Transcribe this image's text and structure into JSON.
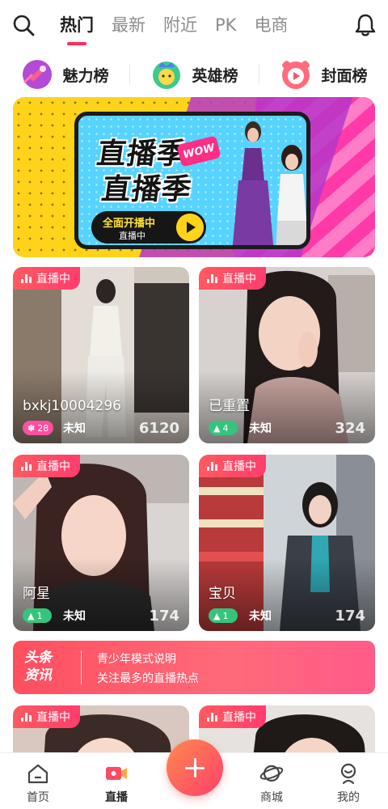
{
  "top_nav": {
    "tabs": [
      {
        "label": "热门",
        "active": true
      },
      {
        "label": "最新",
        "active": false
      },
      {
        "label": "附近",
        "active": false
      },
      {
        "label": "PK",
        "active": false
      },
      {
        "label": "电商",
        "active": false
      }
    ],
    "search_icon": "search-icon",
    "bell_icon": "bell-icon"
  },
  "ranks": [
    {
      "label": "魅力榜",
      "icon": "charm-rank-icon",
      "color": "#e0457a"
    },
    {
      "label": "英雄榜",
      "icon": "hero-rank-icon",
      "color": "#2db57e"
    },
    {
      "label": "封面榜",
      "icon": "cover-rank-icon",
      "color": "#ff5a6e"
    }
  ],
  "banner": {
    "headline_line1": "直播季",
    "headline_line2": "直播季",
    "wow": "WOW",
    "cta_line1": "全面开播中",
    "cta_line2": "直播中"
  },
  "streams": [
    {
      "live_label": "直播中",
      "name": "bxkj10004296",
      "level": "28",
      "level_style": "pink",
      "region": "未知",
      "viewers": "6120"
    },
    {
      "live_label": "直播中",
      "name": "已重置",
      "level": "4",
      "level_style": "green",
      "region": "未知",
      "viewers": "324"
    },
    {
      "live_label": "直播中",
      "name": "阿星",
      "level": "1",
      "level_style": "green",
      "region": "未知",
      "viewers": "174"
    },
    {
      "live_label": "直播中",
      "name": "宝贝",
      "level": "1",
      "level_style": "green",
      "region": "未知",
      "viewers": "174"
    },
    {
      "live_label": "直播中"
    },
    {
      "live_label": "直播中"
    }
  ],
  "news": {
    "badge_line1": "头条",
    "badge_line2": "资讯",
    "line1": "青少年模式说明",
    "line2": "关注最多的直播热点"
  },
  "bottom_nav": [
    {
      "label": "首页",
      "icon": "home-icon",
      "active": false
    },
    {
      "label": "直播",
      "icon": "live-camera-icon",
      "active": true
    },
    {
      "label": "商城",
      "icon": "planet-icon",
      "active": false
    },
    {
      "label": "我的",
      "icon": "profile-icon",
      "active": false
    }
  ],
  "colors": {
    "accent": "#ff2d55",
    "live_badge": "#ff4a62",
    "news_bar": "#ff5a6a"
  }
}
